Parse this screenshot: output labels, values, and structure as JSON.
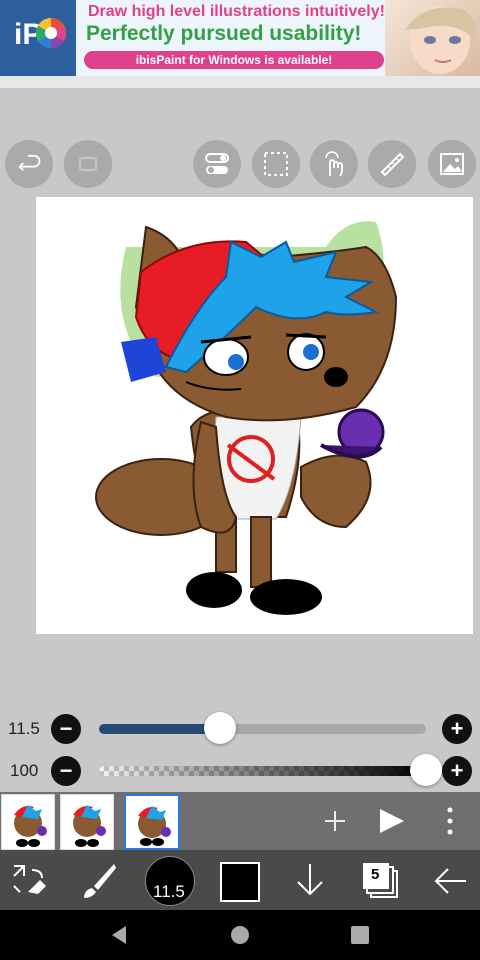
{
  "ad": {
    "logo_text": "iP",
    "line1": "Draw high level illustrations intuitively!",
    "line2": "Perfectly pursued usability!",
    "pill": "ibisPaint for Windows is available!"
  },
  "toolbar": {
    "icons": [
      "undo-icon",
      "redo-icon",
      "toggle-icon",
      "selection-icon",
      "touch-icon",
      "ruler-icon",
      "image-icon"
    ]
  },
  "sliders": {
    "size_value": "11.5",
    "size_fraction": 0.37,
    "opacity_value": "100",
    "opacity_fraction": 1.0
  },
  "layers": {
    "count_badge": "5",
    "selected_index": 2
  },
  "tools": {
    "brush_size": "11.5",
    "color": "#000000"
  },
  "colors": {
    "accent": "#2a7ae2",
    "slider_fill": "#264a73"
  }
}
